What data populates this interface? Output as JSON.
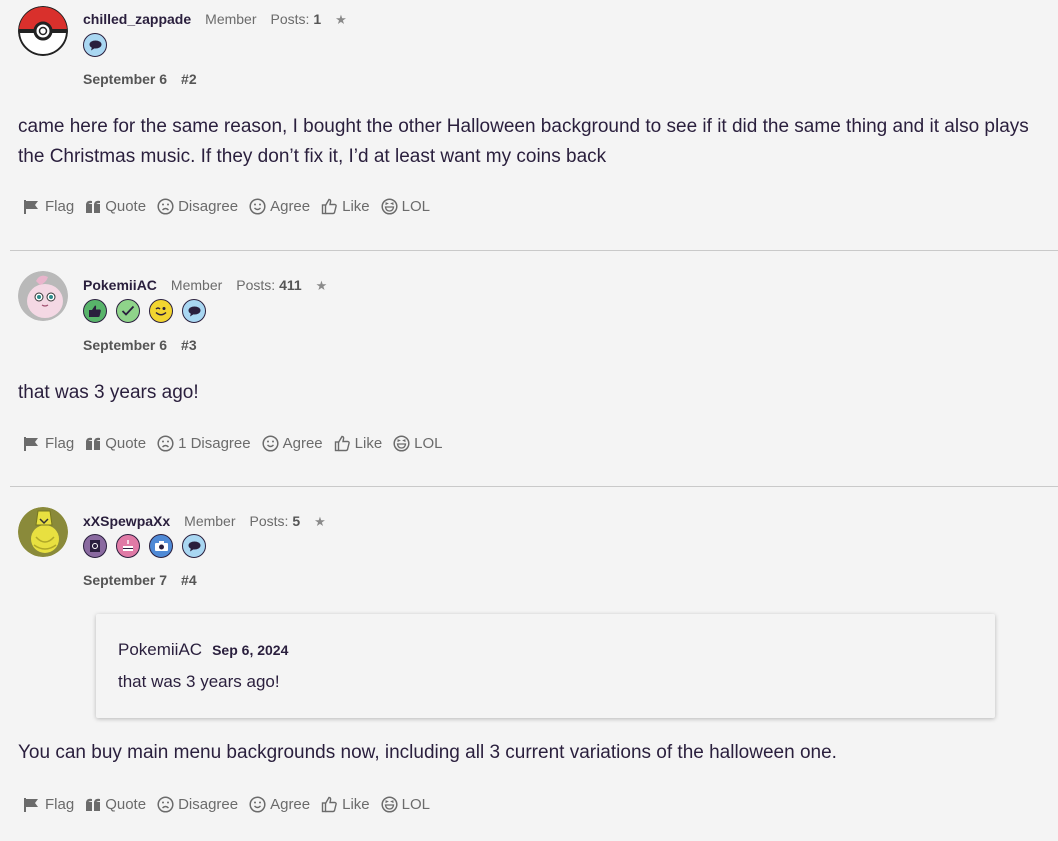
{
  "actions_labels": {
    "flag": "Flag",
    "quote": "Quote",
    "disagree": "Disagree",
    "agree": "Agree",
    "like": "Like",
    "lol": "LOL"
  },
  "posts": [
    {
      "username": "chilled_zappade",
      "role": "Member",
      "posts_label": "Posts:",
      "posts_count": "1",
      "star": "★",
      "date": "September 6",
      "number": "#2",
      "badges": [
        "speech-bubble-icon"
      ],
      "text": "came here for the same reason, I bought the other Halloween background to see if it did the same thing and it also plays the Christmas music. If they don’t fix it, I’d at least want my coins back",
      "disagree_label": "Disagree"
    },
    {
      "username": "PokemiiAC",
      "role": "Member",
      "posts_label": "Posts:",
      "posts_count": "411",
      "star": "★",
      "date": "September 6",
      "number": "#3",
      "badges": [
        "thumbs-up-icon",
        "checkmark-icon",
        "wink-icon",
        "speech-bubble-icon"
      ],
      "text": "that was 3 years ago!",
      "disagree_label": "1 Disagree"
    },
    {
      "username": "xXSpewpaXx",
      "role": "Member",
      "posts_label": "Posts:",
      "posts_count": "5",
      "star": "★",
      "date": "September 7",
      "number": "#4",
      "badges": [
        "book-icon",
        "cake-icon",
        "camera-icon",
        "speech-bubble-icon"
      ],
      "quote": {
        "author": "PokemiiAC",
        "date": "Sep 6, 2024",
        "text": "that was 3 years ago!"
      },
      "text": "You can buy main menu backgrounds now, including all 3 current variations of the halloween one.",
      "disagree_label": "Disagree"
    }
  ],
  "colors": {
    "background": "#f4f4f4",
    "text": "#2a1f3d",
    "muted": "#6b6b6b",
    "badge_green": "#58b46a",
    "badge_light_green": "#8fd48a",
    "badge_yellow": "#f2d530",
    "badge_blue": "#a9d7f2",
    "badge_purple": "#8a6aa0",
    "badge_pink": "#e07aa6",
    "badge_camera_blue": "#4f8ad6"
  }
}
